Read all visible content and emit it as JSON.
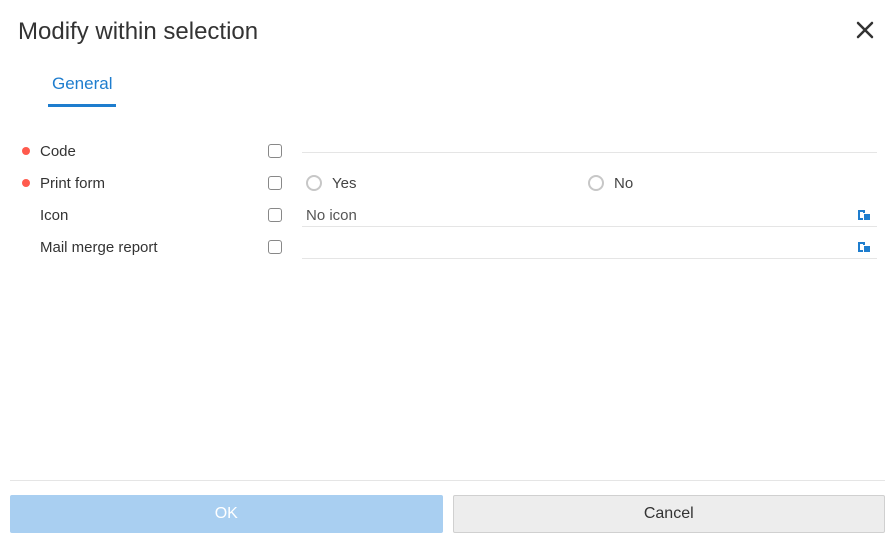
{
  "dialog": {
    "title": "Modify within selection",
    "tabs": {
      "general": "General"
    },
    "fields": {
      "code": {
        "label": "Code",
        "required": true,
        "value": ""
      },
      "printform": {
        "label": "Print form",
        "required": true,
        "yes": "Yes",
        "no": "No"
      },
      "icon": {
        "label": "Icon",
        "required": false,
        "value": "No icon"
      },
      "mailmerge": {
        "label": "Mail merge report",
        "required": false,
        "value": ""
      }
    },
    "buttons": {
      "ok": "OK",
      "cancel": "Cancel"
    },
    "icons": {
      "close": "close-icon",
      "picker": "open-picker-icon"
    }
  }
}
